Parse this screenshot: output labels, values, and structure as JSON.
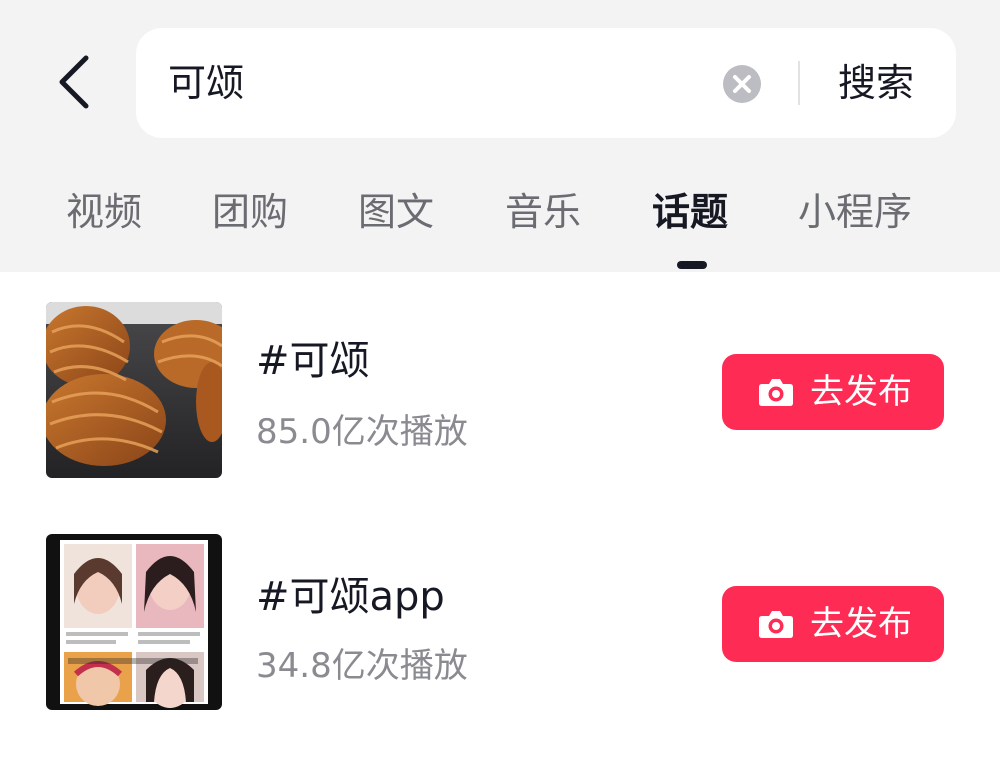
{
  "search": {
    "query": "可颂",
    "submit_label": "搜索"
  },
  "tabs": [
    {
      "label": "视频"
    },
    {
      "label": "团购"
    },
    {
      "label": "图文"
    },
    {
      "label": "音乐"
    },
    {
      "label": "话题",
      "active": true
    },
    {
      "label": "小程序"
    }
  ],
  "topics": [
    {
      "title": "#可颂",
      "stats": "85.0亿次播放",
      "publish_label": "去发布"
    },
    {
      "title": "#可颂app",
      "stats": "34.8亿次播放",
      "publish_label": "去发布"
    }
  ],
  "colors": {
    "accent": "#fe2c55",
    "header_bg": "#f3f3f4",
    "text_primary": "#161823",
    "text_secondary": "#8a8b91"
  },
  "icons": {
    "back": "chevron-left-icon",
    "clear": "clear-circle-icon",
    "publish": "camera-icon"
  }
}
